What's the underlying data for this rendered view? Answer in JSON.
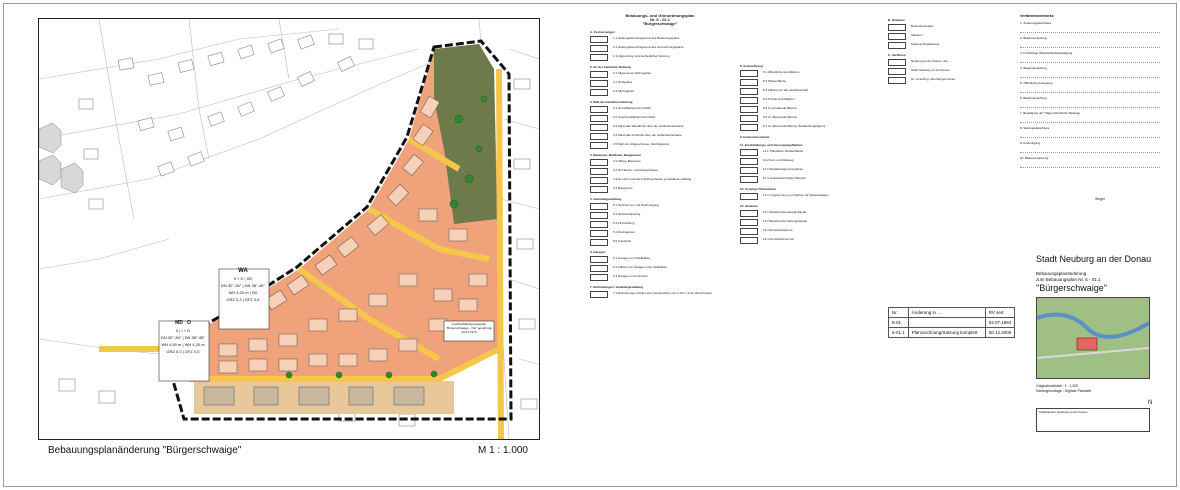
{
  "map": {
    "title": "Bebauungsplanänderung \"Bürgerschwaige\"",
    "scale": "M 1 : 1.000",
    "table_wa_header": "WA",
    "table_wa": [
      [
        "II + D",
        "SD"
      ],
      [
        "DN 30°-35°",
        "DN 38°-45°"
      ],
      [
        "WH 4,20 m",
        "SD"
      ],
      [
        "GRZ 0,3",
        "GFZ 0,6"
      ]
    ],
    "table_md_header": [
      "MD",
      "O"
    ],
    "table_md": [
      [
        "II",
        "I + D"
      ],
      [
        "DN 30°-35°",
        "DN 38°-45°"
      ],
      [
        "WH 4,50 m",
        "WH 4,20 m"
      ],
      [
        "GRZ 0,3",
        "GFZ 0,5"
      ]
    ],
    "annotation_box": "Anschluß/Bebauungsplan \"Bürgerschwaige - Ost\" genehmigt 29.07.1976",
    "colors": {
      "residential": "#f0a27a",
      "mixed": "#e8c89a",
      "green": "#6f7a4c",
      "road": "#f5c64a",
      "building": "#f7d0b8"
    }
  },
  "legend": {
    "header": "Bebauungs- und Grünordnungsplan",
    "plan_no": "Nr. 6 - 01.1",
    "plan_name": "\"Bürgerschwaige\"",
    "sections": [
      {
        "title": "A. Festsetzungen",
        "rows": [
          "1.1 Geltungsbereichsgrenze des Bebauungsplans",
          "1.2 Geltungsbereichsgrenze des Grünordnungsplans",
          "1.3 Abgrenzung unterschiedlicher Nutzung"
        ]
      },
      {
        "title": "2. Art der baulichen Nutzung",
        "rows": [
          "2.1 Allgemeines Wohngebiet",
          "2.2 Dorfgebiet",
          "2.3 Mischgebiet"
        ]
      },
      {
        "title": "3. Maß der baulichen Nutzung",
        "rows": [
          "3.1 Grundflächenzahl (GRZ)",
          "3.2 Geschossflächenzahl (GFZ)",
          "3.3 Maximale Wandhöhe über der Geländeoberkante",
          "3.4 Maximale Firsthöhe über der Geländeoberkante",
          "3.5 Zahl der Vollgeschosse, Höchstgrenze"
        ]
      },
      {
        "title": "4. Bauweise, Baulinien, Baugrenzen",
        "rows": [
          "4.1 Offene Bauweise",
          "4.2 Nur Einzel- und Doppelhäuser",
          "4.3 Es sind maximal 2 Wohneinheiten je Gebäude zulässig",
          "4.4 Baugrenze"
        ]
      },
      {
        "title": "5. Gebäudegestaltung",
        "rows": [
          "5.1 Dachformen und Dachneigung",
          "5.2 Dacheindeckung",
          "5.3 Firstrichtung",
          "5.4 Dachgauben",
          "5.5 Kniestock"
        ]
      },
      {
        "title": "6. Garagen",
        "rows": [
          "6.1 Garagen und Stellplätze",
          "6.2 Flächen für Garagen oder Stellplätze",
          "6.3 Garagen und Carports"
        ]
      },
      {
        "title": "7. Einfriedungen / Geländegestaltung",
        "rows": [
          "7.1 Einfriedungen dürfen eine Gesamthöhe von 1,20 m nicht überschreiten"
        ]
      }
    ],
    "col2": [
      {
        "title": "8. Grünordnung",
        "rows": [
          "8.1 Öffentliche Grünflächen",
          "8.2 Wasserfläche",
          "8.3 Flächen für die Landwirtschaft",
          "8.4 Private Grünflächen",
          "8.5 zu erhaltende Bäume",
          "8.6 zu pflanzende Bäume",
          "8.7 zu pflanzende Bäume (Straßenbegleitgrün)"
        ]
      },
      {
        "title": "9. Immissionsschutz",
        "rows": []
      },
      {
        "title": "11. Erschließungs- und Versorgungsflächen",
        "rows": [
          "11.1 Öffentliche Straßenfläche",
          "11.2 Fuß- und Radweg",
          "11.3 Straßenbegrenzungslinie",
          "11.4 Verkehrsberuhigter Bereich"
        ]
      },
      {
        "title": "12. Sonstige Planzeichen",
        "rows": [
          "12.1 Umgrenzung von Flächen für Nebenanlagen"
        ]
      },
      {
        "title": "13. Hinweise",
        "rows": [
          "13.1 Bestehende Hauptgebäude",
          "13.2 Bestehende Nebengebäude",
          "13.3 Flurstücksgrenze",
          "13.4 Flurstücksnummer"
        ]
      }
    ],
    "col3": [
      {
        "title": "B. Hinweise",
        "rows": [
          "Bodendenkmäler",
          "Altlasten",
          "Niederschlagswasser"
        ]
      },
      {
        "title": "C. Verfahren",
        "rows": [
          "Neuburg an der Donau, den ...",
          "Stadt Neuburg an der Donau",
          "Dr. Gmehling, Oberbürgermeister"
        ]
      }
    ]
  },
  "procedure": {
    "header": "Verfahrensvermerke",
    "items": [
      "1. Änderungsbeschluss",
      "2. Bekanntmachung",
      "3. Frühzeitige Öffentlichkeitsbeteiligung",
      "4. Bekanntmachung",
      "5. Öffentliche Auslegung",
      "6. Bekanntmachung",
      "7. Beteiligung der Träger öffentlicher Belange",
      "8. Satzungsbeschluss",
      "9. Ausfertigung",
      "10. Bekanntmachung"
    ],
    "stamp": "Siegel"
  },
  "title_block": {
    "city": "Stadt Neuburg an der Donau",
    "subtitle1": "Bebauungsplanänderung",
    "subtitle2": "zum Bebauungsplan Nr. 6 - 01.1",
    "plan_name": "\"Bürgerschwaige\"",
    "scale_label": "Originalmaßstab   :   1 : 1.000",
    "basis_label": "Kartengrundlage  :  Digitale Flurkarte",
    "office": "Stadtbauamt Neuburg an der Donau",
    "north": "N"
  },
  "amendments": {
    "headers": [
      "Nr.",
      "Änderung in ...",
      "RV seit:"
    ],
    "rows": [
      [
        "6-01",
        "",
        "04.07.1984"
      ],
      [
        "6-01.1",
        "Planzeichnung/Satzung komplett",
        "30.12.2006"
      ]
    ]
  }
}
